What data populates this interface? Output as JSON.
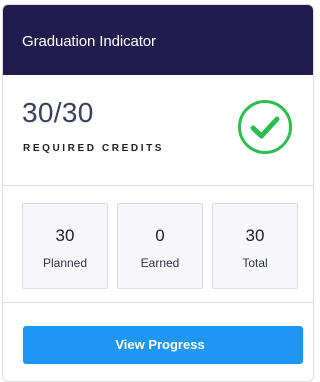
{
  "header": {
    "title": "Graduation Indicator"
  },
  "summary": {
    "fraction": "30/30",
    "label": "REQUIRED CREDITS",
    "status_icon": "check-circle-icon",
    "status_color": "#2dbd4e"
  },
  "stats": [
    {
      "value": "30",
      "label": "Planned"
    },
    {
      "value": "0",
      "label": "Earned"
    },
    {
      "value": "30",
      "label": "Total"
    }
  ],
  "actions": {
    "view_progress_label": "View Progress",
    "button_color": "#1e96f4"
  },
  "colors": {
    "header_bg": "#221c4e",
    "card_border": "#dcdde3",
    "stat_bg": "#f6f6fb"
  }
}
